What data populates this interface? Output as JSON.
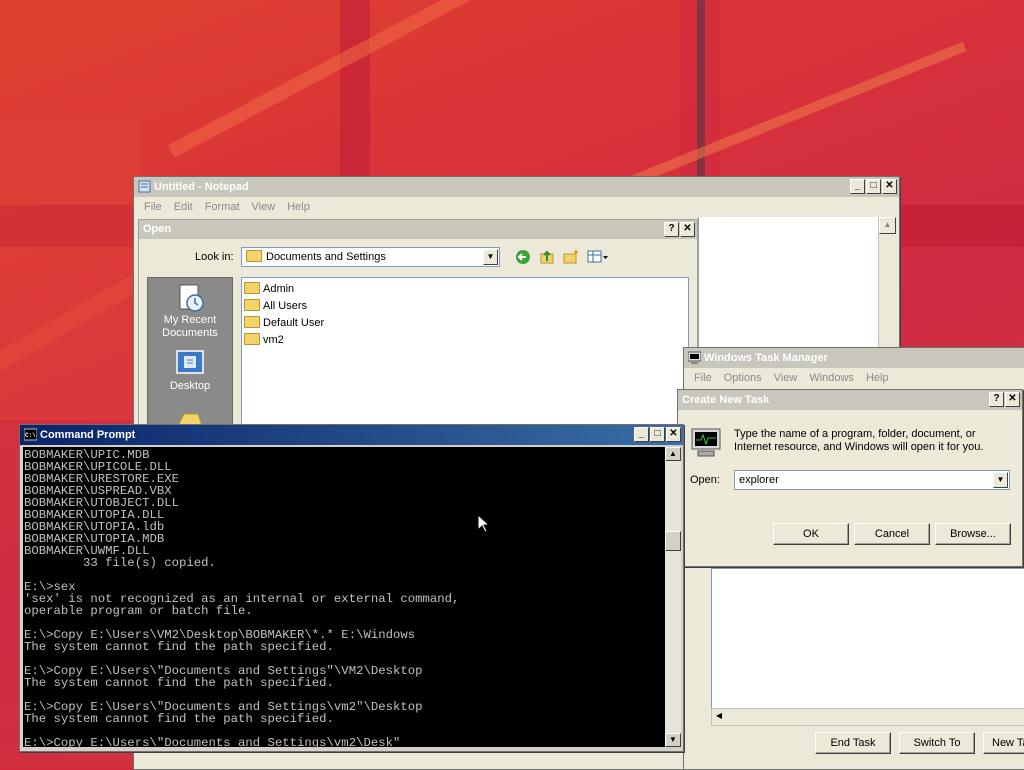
{
  "notepad": {
    "title": "Untitled - Notepad",
    "menu": [
      "File",
      "Edit",
      "Format",
      "View",
      "Help"
    ]
  },
  "open_dialog": {
    "title": "Open",
    "lookin_label": "Look in:",
    "lookin_value": "Documents and Settings",
    "places": [
      {
        "label1": "My Recent",
        "label2": "Documents",
        "icon": "recent-documents-icon"
      },
      {
        "label1": "Desktop",
        "label2": "",
        "icon": "desktop-icon"
      }
    ],
    "files": [
      "Admin",
      "All Users",
      "Default User",
      "vm2"
    ]
  },
  "cmd": {
    "title": "Command Prompt",
    "lines": [
      "BOBMAKER\\UPIC.MDB",
      "BOBMAKER\\UPICOLE.DLL",
      "BOBMAKER\\URESTORE.EXE",
      "BOBMAKER\\USPREAD.VBX",
      "BOBMAKER\\UTOBJECT.DLL",
      "BOBMAKER\\UTOPIA.DLL",
      "BOBMAKER\\UTOPIA.ldb",
      "BOBMAKER\\UTOPIA.MDB",
      "BOBMAKER\\UWMF.DLL",
      "        33 file(s) copied.",
      "",
      "E:\\>sex",
      "'sex' is not recognized as an internal or external command,",
      "operable program or batch file.",
      "",
      "E:\\>Copy E:\\Users\\VM2\\Desktop\\BOBMAKER\\*.* E:\\Windows",
      "The system cannot find the path specified.",
      "",
      "E:\\>Copy E:\\Users\\\"Documents and Settings\"\\VM2\\Desktop",
      "The system cannot find the path specified.",
      "",
      "E:\\>Copy E:\\Users\\\"Documents and Settings\\vm2\"\\Desktop",
      "The system cannot find the path specified.",
      "",
      "E:\\>Copy E:\\Users\\\"Documents and Settings\\vm2\\Desk\""
    ]
  },
  "taskmgr": {
    "title": "Windows Task Manager",
    "menu": [
      "File",
      "Options",
      "View",
      "Windows",
      "Help"
    ],
    "buttons": {
      "end_task": "End Task",
      "switch_to": "Switch To",
      "new_task": "New Ta"
    }
  },
  "create_task": {
    "title": "Create New Task",
    "prompt": "Type the name of a program, folder, document, or Internet resource, and Windows will open it for you.",
    "open_label": "Open:",
    "open_value": "explorer",
    "buttons": {
      "ok": "OK",
      "cancel": "Cancel",
      "browse": "Browse..."
    }
  }
}
